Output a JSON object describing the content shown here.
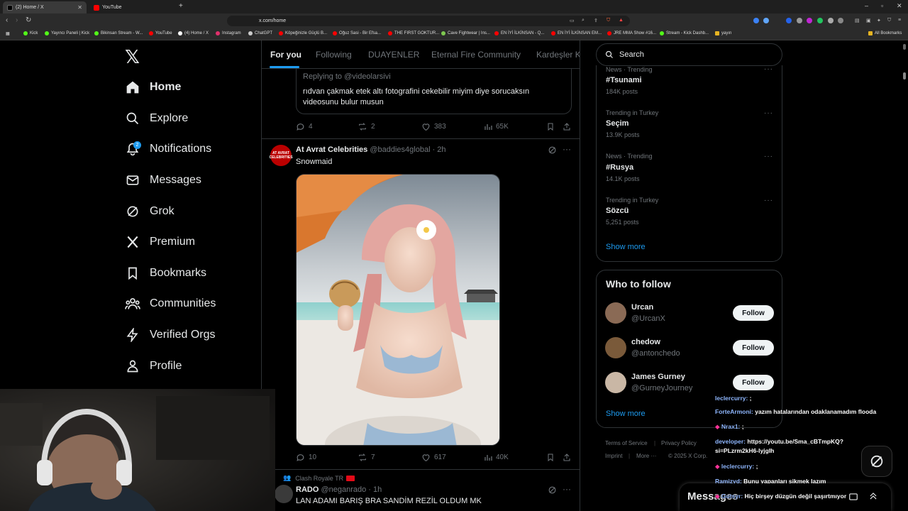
{
  "browser": {
    "tabs": [
      {
        "title": "(2) Home / X",
        "active": true
      },
      {
        "title": "YouTube",
        "active": false
      }
    ],
    "url": "x.com/home",
    "bookmarks": [
      "Kick",
      "Yayıncı Paneli | Kick",
      "Bikinsan Stream - W...",
      "YouTube",
      "(4) Home / X",
      "Instagram",
      "ChatGPT",
      "Köpeğinizle Güçlü B...",
      "Oğuz Sasi - Bir Efsa...",
      "THE FIRST GOKTUR...",
      "Cave Fightwear | Ins...",
      "EN İYİ İLKİNSAN - Q...",
      "EN İYİ İLKİNSAN EM...",
      "JRE MMA Show #16...",
      "Stream - Kick Dashb...",
      "yayın"
    ],
    "all_bookmarks": "All Bookmarks"
  },
  "nav": {
    "items": [
      {
        "label": "Home",
        "icon": "home-icon"
      },
      {
        "label": "Explore",
        "icon": "search-icon"
      },
      {
        "label": "Notifications",
        "icon": "bell-icon",
        "badge": "2"
      },
      {
        "label": "Messages",
        "icon": "mail-icon"
      },
      {
        "label": "Grok",
        "icon": "grok-icon"
      },
      {
        "label": "Premium",
        "icon": "x-icon"
      },
      {
        "label": "Bookmarks",
        "icon": "bookmark-icon"
      },
      {
        "label": "Communities",
        "icon": "people-icon"
      },
      {
        "label": "Verified Orgs",
        "icon": "lightning-icon"
      },
      {
        "label": "Profile",
        "icon": "person-icon"
      }
    ]
  },
  "feed": {
    "tabs": [
      "For you",
      "Following",
      "DUAYENLER",
      "Eternal Fire Community",
      "Kardeşler K"
    ],
    "quote": {
      "replying_to": "Replying to @videolarsivi",
      "text_line1": "rıdvan çakmak etek altı fotografini cekebilir miyim diye sorucaksın",
      "text_line2": "videosunu bulur musun"
    },
    "post0_stats": {
      "replies": "4",
      "reposts": "2",
      "likes": "383",
      "views": "65K"
    },
    "post1": {
      "name": "At Avrat Celebrities",
      "handle": "@baddies4global · 2h",
      "text": "Snowmaid",
      "stats": {
        "replies": "10",
        "reposts": "7",
        "likes": "617",
        "views": "40K"
      }
    },
    "post2": {
      "social_context": "Clash Royale TR",
      "name": "RADO",
      "handle": "@neganrado · 1h",
      "text": "LAN ADAMI BARIŞ BRA SANDİM REZİL OLDUM MK"
    }
  },
  "sidebar": {
    "search_placeholder": "Search",
    "trends": [
      {
        "meta": "News · Trending",
        "name": "#Tsunami",
        "count": "184K posts"
      },
      {
        "meta": "Trending in Turkey",
        "name": "Seçim",
        "count": "13.9K posts"
      },
      {
        "meta": "News · Trending",
        "name": "#Rusya",
        "count": "14.1K posts"
      },
      {
        "meta": "Trending in Turkey",
        "name": "Sözcü",
        "count": "5,251 posts"
      }
    ],
    "show_more": "Show more",
    "who_to_follow": {
      "title": "Who to follow",
      "users": [
        {
          "name": "Urcan",
          "handle": "@UrcanX"
        },
        {
          "name": "chedow",
          "handle": "@antonchedo"
        },
        {
          "name": "James Gurney",
          "handle": "@GurneyJourney"
        }
      ],
      "follow_label": "Follow",
      "show_more": "Show more"
    },
    "footer": {
      "terms": "Terms of Service",
      "privacy": "Privacy Policy",
      "imprint": "Imprint",
      "more": "More ···",
      "copyright": "© 2025 X Corp."
    }
  },
  "chat": [
    {
      "user": "FortеArmoni:",
      "msg": "yazım hatalarından odaklanamadım flooda"
    },
    {
      "user": "Nrax1:",
      "msg": ";"
    },
    {
      "user": "developer:",
      "msg": "https://youtu.be/Sma_cBTmpKQ?"
    },
    {
      "user": "",
      "msg": "si=PLzrm2kH6-lyjgIh"
    },
    {
      "user": "leclercurry:",
      "msg": ";"
    },
    {
      "user": "Ramizyd:",
      "msg": "Bunu yapanları sikmek lazım"
    },
    {
      "user": "Gutsyr:",
      "msg": "Hiç birşey düzgün değil şaşırtmıyor"
    }
  ],
  "messages_bar": "Messages"
}
